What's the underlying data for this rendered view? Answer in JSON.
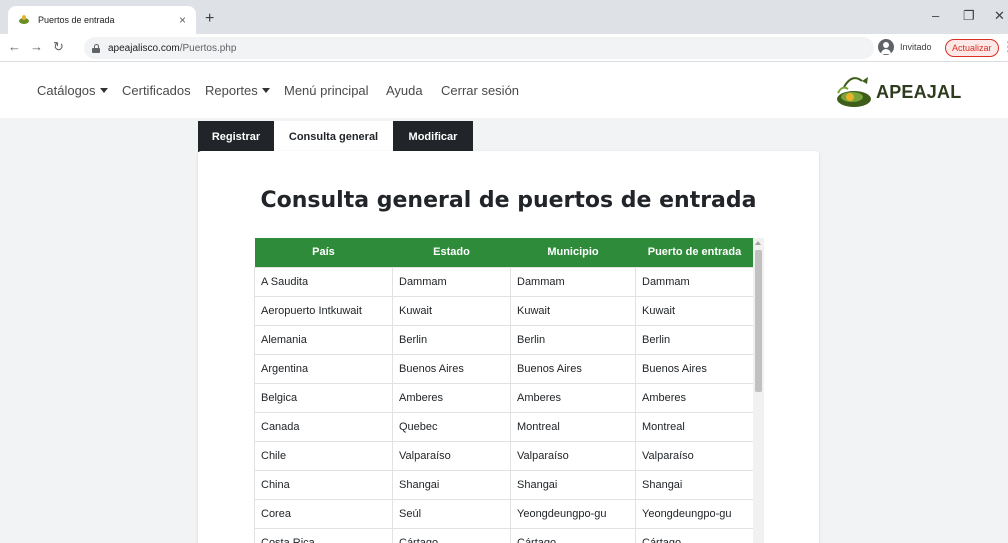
{
  "browser": {
    "tab_title": "Puertos de entrada",
    "tab_close": "×",
    "new_tab": "+",
    "url_host": "apeajalisco.com",
    "url_path": "/Puertos.php",
    "profile_label": "Invitado",
    "update_label": "Actualizar"
  },
  "nav": {
    "catalogos": "Catálogos",
    "certificados": "Certificados",
    "reportes": "Reportes",
    "menu_principal": "Menú principal",
    "ayuda": "Ayuda",
    "cerrar_sesion": "Cerrar sesión",
    "logo_text": "APEAJAL"
  },
  "tabs": {
    "registrar": "Registrar",
    "consulta": "Consulta general",
    "modificar": "Modificar"
  },
  "page_title": "Consulta general de puertos de entrada",
  "table": {
    "headers": [
      "País",
      "Estado",
      "Municipio",
      "Puerto de entrada"
    ],
    "rows": [
      [
        "A Saudita",
        "Dammam",
        "Dammam",
        "Dammam"
      ],
      [
        "Aeropuerto Intkuwait",
        "Kuwait",
        "Kuwait",
        "Kuwait"
      ],
      [
        "Alemania",
        "Berlin",
        "Berlin",
        "Berlin"
      ],
      [
        "Argentina",
        "Buenos Aires",
        "Buenos Aires",
        "Buenos Aires"
      ],
      [
        "Belgica",
        "Amberes",
        "Amberes",
        "Amberes"
      ],
      [
        "Canada",
        "Quebec",
        "Montreal",
        "Montreal"
      ],
      [
        "Chile",
        "Valparaíso",
        "Valparaíso",
        "Valparaíso"
      ],
      [
        "China",
        "Shangai",
        "Shangai",
        "Shangai"
      ],
      [
        "Corea",
        "Seúl",
        "Yeongdeungpo-gu",
        "Yeongdeungpo-gu"
      ],
      [
        "Costa Rica",
        "Cártago",
        "Cártago",
        "Cártago"
      ]
    ]
  },
  "colors": {
    "header_green": "#2e8b3a",
    "dark_tab": "#212529",
    "logo_green": "#6b8e23",
    "logo_yellow": "#e7b32a"
  }
}
